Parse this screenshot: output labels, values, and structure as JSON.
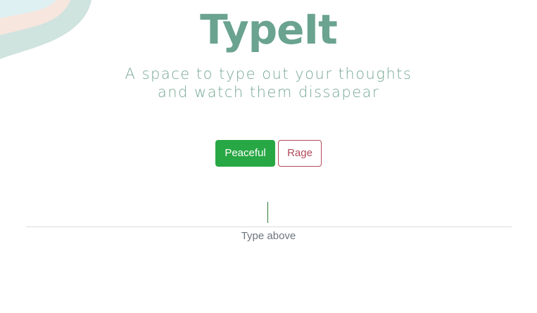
{
  "app": {
    "title": "TypeIt",
    "subtitle_line1": "A space to type out your thoughts",
    "subtitle_line2": "and watch them dissapear"
  },
  "modes": {
    "peaceful_label": "Peaceful",
    "rage_label": "Rage"
  },
  "typing": {
    "value": "",
    "hint": "Type above"
  },
  "colors": {
    "brand": "#6aa38f",
    "peaceful": "#28a745",
    "rage": "#b24a5a"
  },
  "icons": {
    "decor": "wave-shape-decoration"
  }
}
